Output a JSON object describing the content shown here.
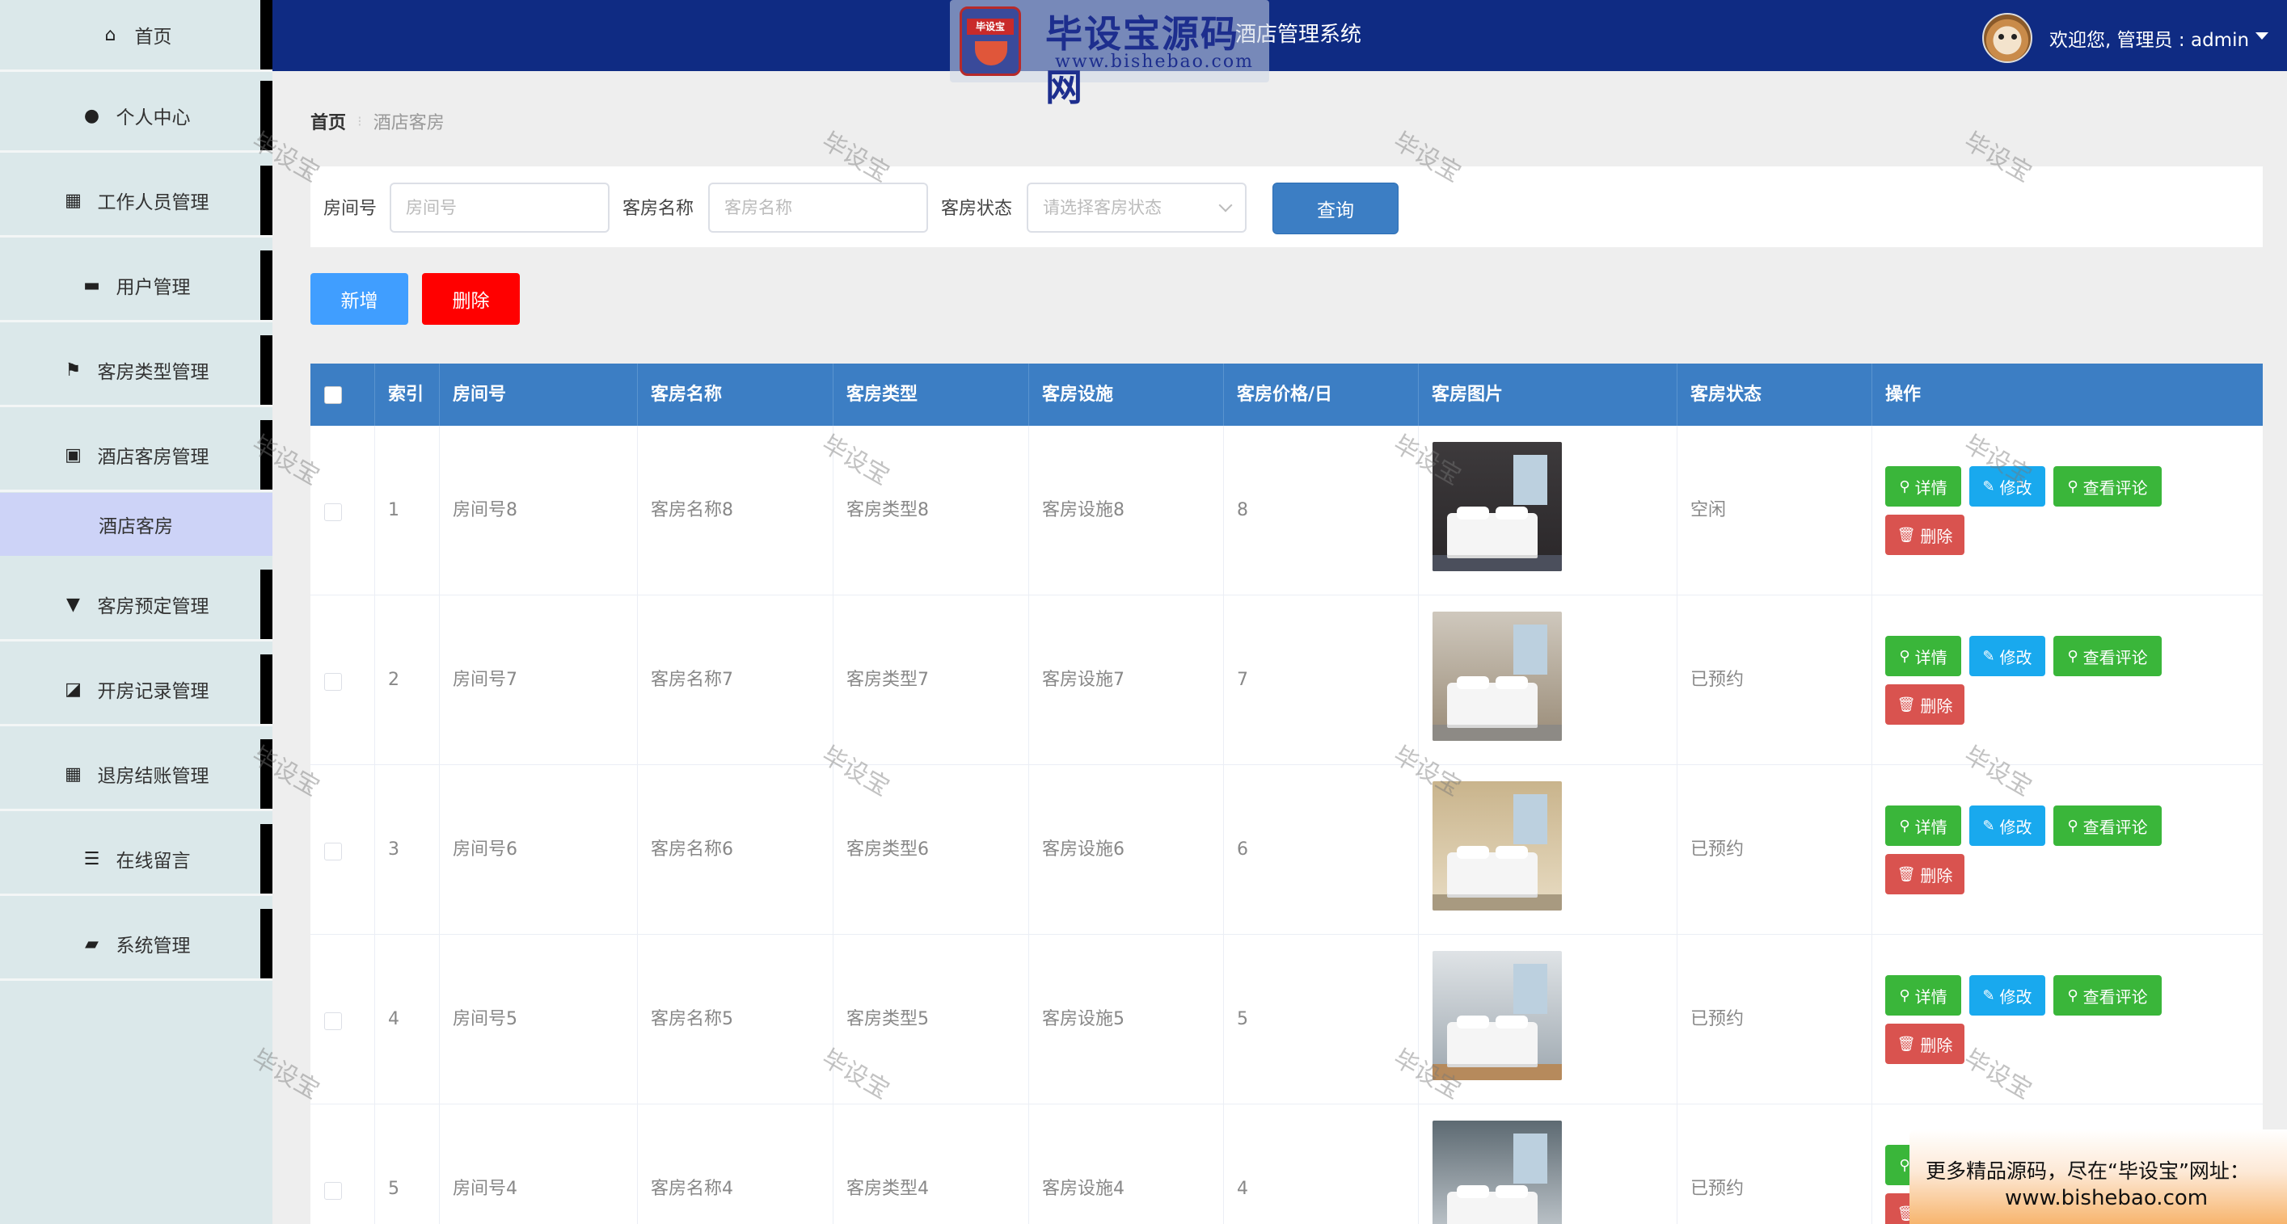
{
  "header": {
    "system_title": "酒店管理系统",
    "logo_text": "毕设宝源码网",
    "logo_badge": "毕设宝",
    "logo_url": "www.bishebao.com",
    "welcome": "欢迎您,  管理员 : admin"
  },
  "sidebar": {
    "items": [
      {
        "label": "首页",
        "icon": "home-icon"
      },
      {
        "label": "个人中心",
        "icon": "user-icon"
      },
      {
        "label": "工作人员管理",
        "icon": "grid-icon"
      },
      {
        "label": "用户管理",
        "icon": "drawer-icon"
      },
      {
        "label": "客房类型管理",
        "icon": "flag-icon"
      },
      {
        "label": "酒店客房管理",
        "icon": "clipboard-icon"
      },
      {
        "label": "客房预定管理",
        "icon": "paint-icon"
      },
      {
        "label": "开房记录管理",
        "icon": "chart-icon"
      },
      {
        "label": "退房结账管理",
        "icon": "grid-icon"
      },
      {
        "label": "在线留言",
        "icon": "list-icon"
      },
      {
        "label": "系统管理",
        "icon": "briefcase-icon"
      }
    ],
    "active_sub": "酒店客房"
  },
  "breadcrumb": {
    "home": "首页",
    "current": "酒店客房"
  },
  "search": {
    "room_no_label": "房间号",
    "room_no_placeholder": "房间号",
    "room_name_label": "客房名称",
    "room_name_placeholder": "客房名称",
    "status_label": "客房状态",
    "status_placeholder": "请选择客房状态",
    "query_label": "查询"
  },
  "actions": {
    "add_label": "新增",
    "delete_label": "删除"
  },
  "table": {
    "headers": [
      "索引",
      "房间号",
      "客房名称",
      "客房类型",
      "客房设施",
      "客房价格/日",
      "客房图片",
      "客房状态",
      "操作"
    ],
    "rows": [
      {
        "index": "1",
        "room_no": "房间号8",
        "name": "客房名称8",
        "type": "客房类型8",
        "facility": "客房设施8",
        "price": "8",
        "status": "空闲"
      },
      {
        "index": "2",
        "room_no": "房间号7",
        "name": "客房名称7",
        "type": "客房类型7",
        "facility": "客房设施7",
        "price": "7",
        "status": "已预约"
      },
      {
        "index": "3",
        "room_no": "房间号6",
        "name": "客房名称6",
        "type": "客房类型6",
        "facility": "客房设施6",
        "price": "6",
        "status": "已预约"
      },
      {
        "index": "4",
        "room_no": "房间号5",
        "name": "客房名称5",
        "type": "客房类型5",
        "facility": "客房设施5",
        "price": "5",
        "status": "已预约"
      },
      {
        "index": "5",
        "room_no": "房间号4",
        "name": "客房名称4",
        "type": "客房类型4",
        "facility": "客房设施4",
        "price": "4",
        "status": "已预约"
      }
    ],
    "op_labels": {
      "detail": "详情",
      "edit": "修改",
      "review": "查看评论",
      "delete": "删除"
    }
  },
  "watermark": "毕设宝",
  "promo": {
    "line1": "更多精品源码，尽在“毕设宝”网址：",
    "line2": "www.bishebao.com"
  },
  "colors": {
    "header_bg": "#0f2b83",
    "table_header": "#3c7ec4",
    "sidebar_bg": "#dbe8ea",
    "add": "#409eff",
    "delete": "#ff0000",
    "detail": "#3ab63a",
    "edit": "#19a9ee",
    "row_delete": "#d9534f"
  }
}
